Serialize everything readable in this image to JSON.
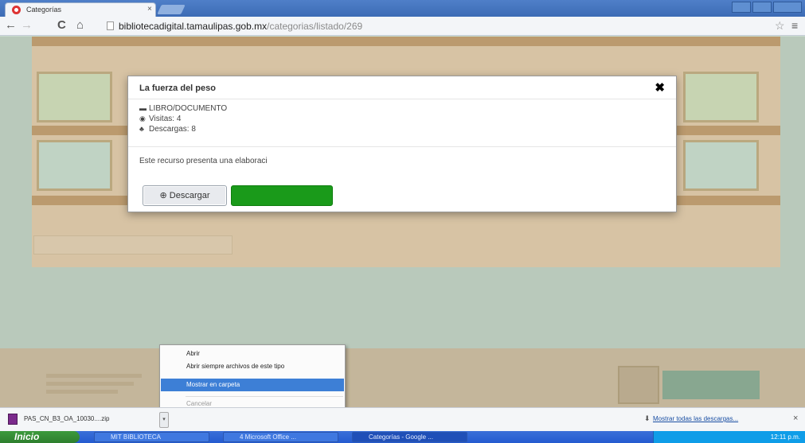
{
  "browser": {
    "tab_title": "Categorías",
    "tab_close": "×",
    "url_host": "bibliotecadigital.tamaulipas.gob.mx",
    "url_path": "/categorias/listado/269",
    "back_icon": "←",
    "forward_icon": "→",
    "reload_icon": "C",
    "home_icon": "⌂",
    "star_icon": "☆",
    "menu_icon": "≡"
  },
  "modal": {
    "title": "La fuerza del peso",
    "close": "✖",
    "type_label": "LIBRO/DOCUMENTO",
    "views_label": "Visitas: 4",
    "downloads_label": "Descargas: 8",
    "description": "Este recurso presenta una elaboraci",
    "download_button": "Descargar",
    "download_icon": "⊕",
    "folder_icon": "▬",
    "eye_icon": "◉",
    "user_icon": "♣"
  },
  "context_menu": {
    "items": [
      {
        "label": "Abrir",
        "state": "normal"
      },
      {
        "label": "Abrir siempre archivos de este tipo",
        "state": "normal"
      },
      {
        "label": "Mostrar en carpeta",
        "state": "highlighted"
      },
      {
        "label": "Cancelar",
        "state": "disabled"
      }
    ]
  },
  "download_bar": {
    "file_name": "PAS_CN_B3_OA_10030....zip",
    "show_all": "Mostrar todas las descargas...",
    "close": "×",
    "arrow": "▾"
  },
  "taskbar": {
    "start_label": "Inicio",
    "tasks": [
      "MIT BIBLIOTECA",
      "4 Microsoft Office ...",
      "Categorías - Google ..."
    ],
    "clock": "12:11 p.m."
  },
  "colors": {
    "modal_green": "#1a9a1a",
    "highlight_blue": "#3d7fd6",
    "taskbar_blue": "#245bd0"
  }
}
